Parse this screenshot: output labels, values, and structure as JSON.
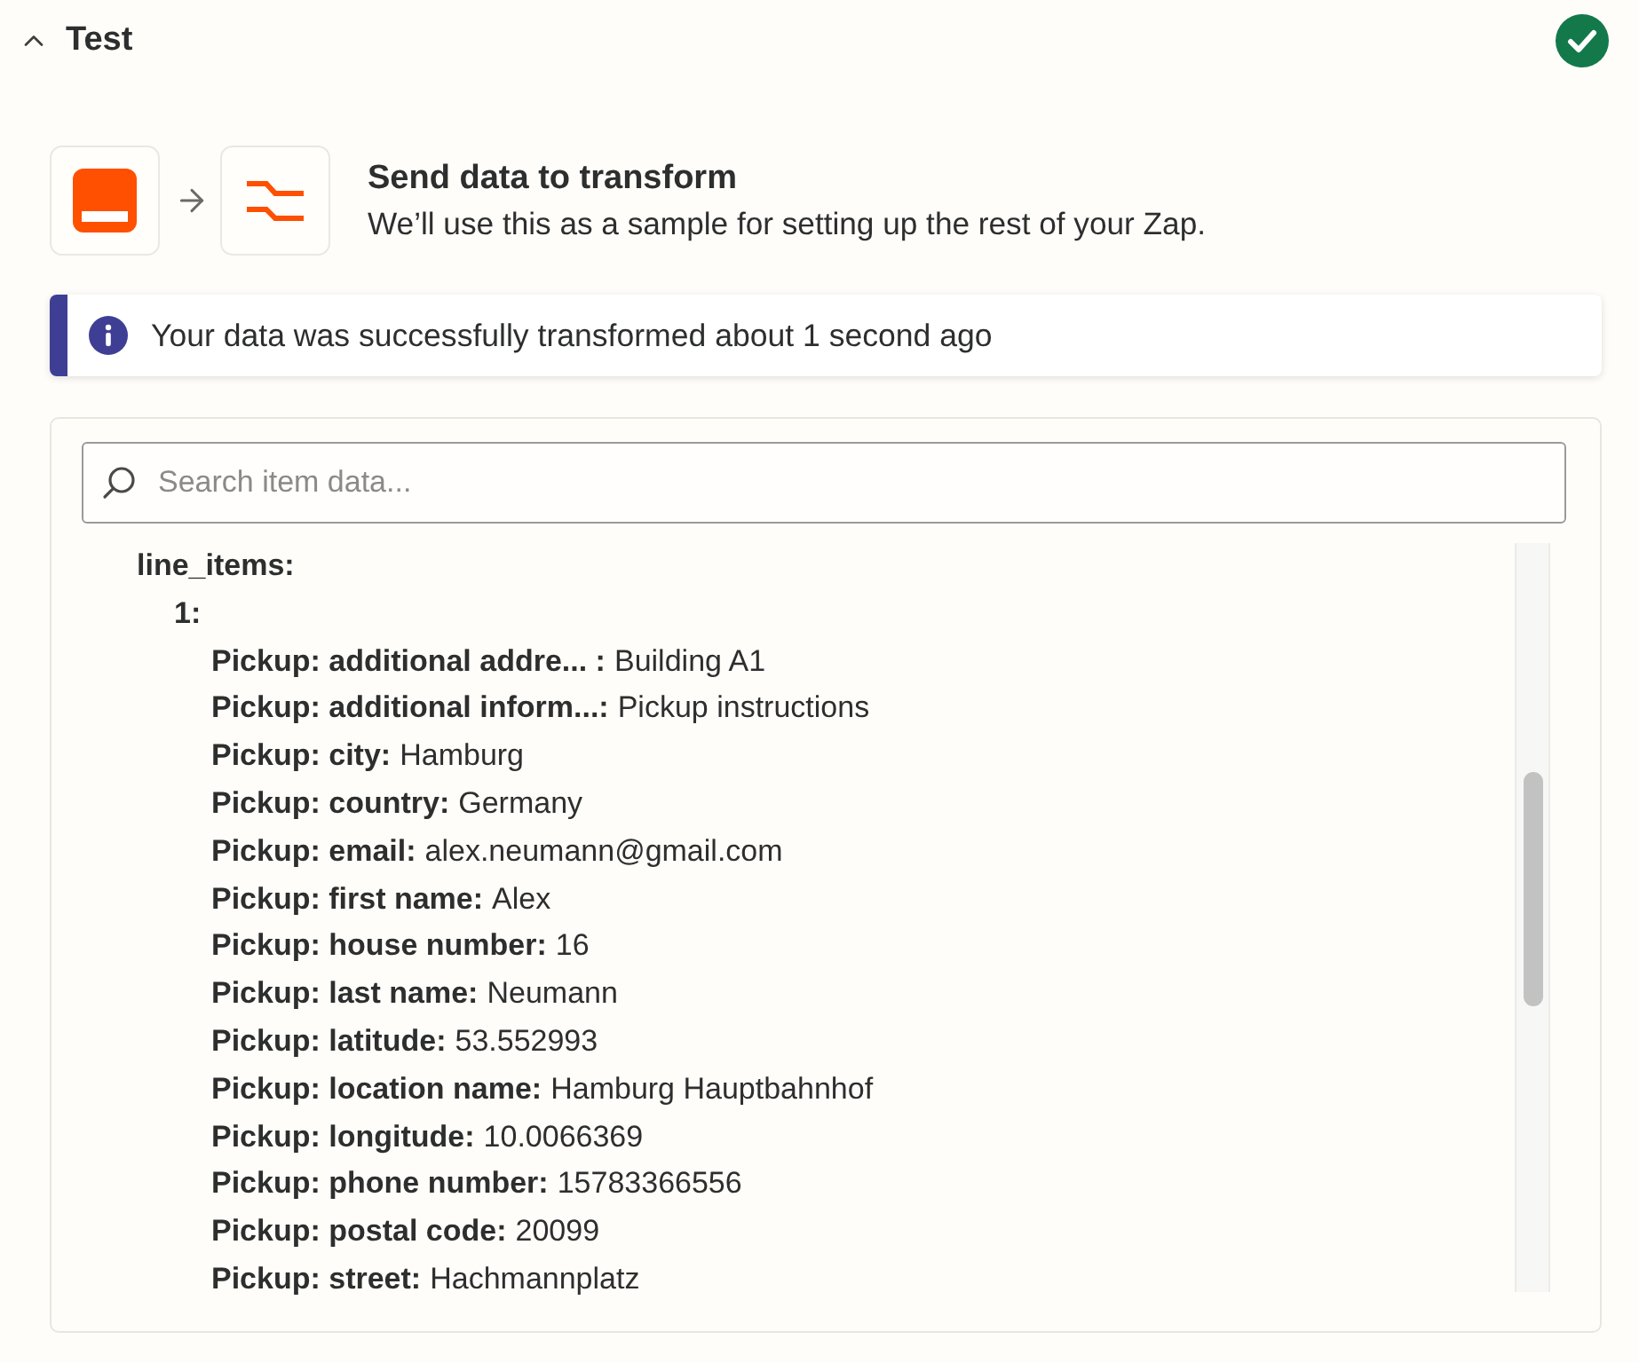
{
  "section": {
    "title": "Test",
    "expanded": true,
    "complete": true
  },
  "step": {
    "title": "Send data to transform",
    "subtitle": "We’ll use this as a sample for setting up the rest of your Zap."
  },
  "alert": {
    "message": "Your data was successfully transformed about 1 second ago"
  },
  "search": {
    "placeholder": "Search item data..."
  },
  "data_tree": [
    {
      "label": "line_items:",
      "children": [
        {
          "label": "1:",
          "children": [
            {
              "label": "Pickup: additional addre... :",
              "value": "Building A1"
            },
            {
              "label": "Pickup: additional inform...:",
              "value": "Pickup instructions"
            },
            {
              "label": "Pickup: city:",
              "value": "Hamburg"
            },
            {
              "label": "Pickup: country:",
              "value": "Germany"
            },
            {
              "label": "Pickup: email:",
              "value": "alex.neumann@gmail.com"
            },
            {
              "label": "Pickup: first name:",
              "value": "Alex"
            },
            {
              "label": "Pickup: house number:",
              "value": "16"
            },
            {
              "label": "Pickup: last name:",
              "value": "Neumann"
            },
            {
              "label": "Pickup: latitude:",
              "value": "53.552993"
            },
            {
              "label": "Pickup: location name:",
              "value": "Hamburg Hauptbahnhof"
            },
            {
              "label": "Pickup: longitude:",
              "value": "10.0066369"
            },
            {
              "label": "Pickup: phone number:",
              "value": "15783366556"
            },
            {
              "label": "Pickup: postal code:",
              "value": "20099"
            },
            {
              "label": "Pickup: street:",
              "value": "Hachmannplatz"
            }
          ]
        }
      ]
    }
  ]
}
